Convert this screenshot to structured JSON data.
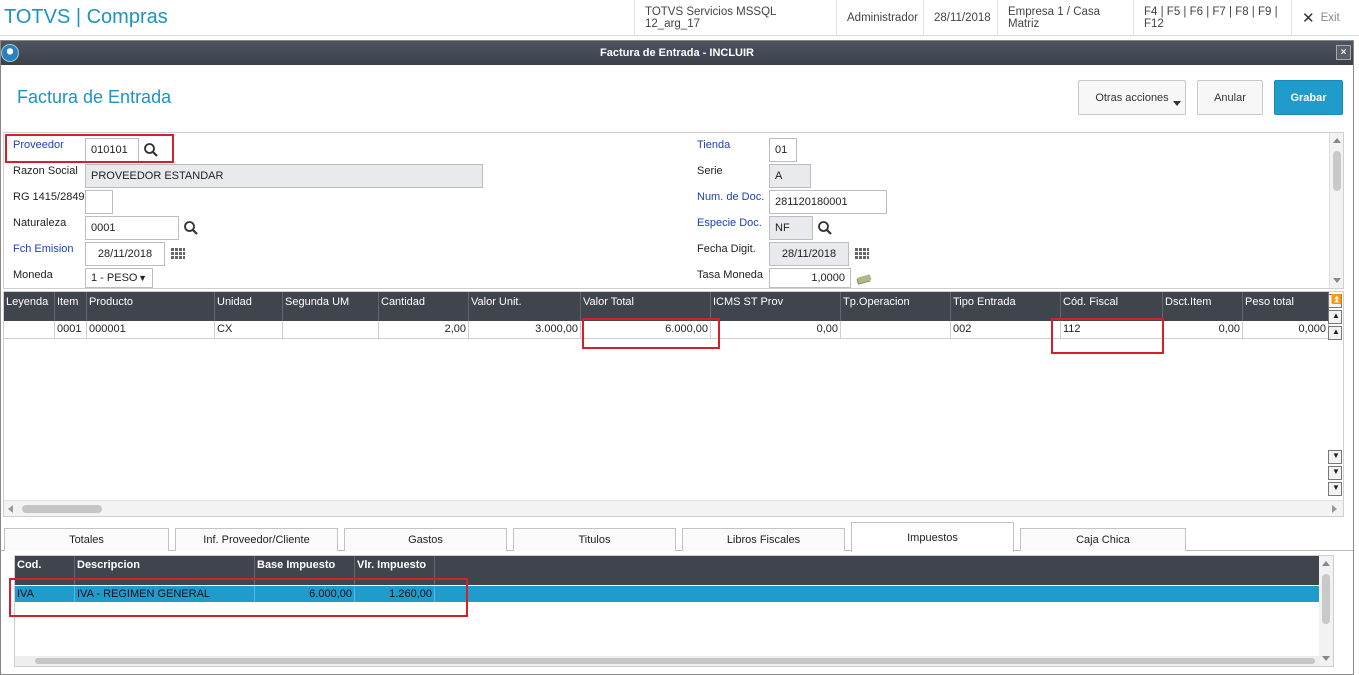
{
  "app": {
    "title": "TOTVS | Compras",
    "environment": "TOTVS Servicios MSSQL 12_arg_17",
    "user": "Administrador",
    "date": "28/11/2018",
    "company": "Empresa 1 / Casa Matriz",
    "shortcuts": "F4 | F5 | F6 | F7 | F8 | F9 | F12",
    "exit_label": "Exit"
  },
  "dialog": {
    "title": "Factura de Entrada - INCLUIR",
    "close_glyph": "×"
  },
  "header": {
    "page_title": "Factura de Entrada",
    "other_actions": "Otras acciones",
    "cancel": "Anular",
    "save": "Grabar"
  },
  "form": {
    "proveedor": {
      "label": "Proveedor",
      "value": "010101"
    },
    "razon_social": {
      "label": "Razon Social",
      "value": "PROVEEDOR ESTANDAR"
    },
    "rg": {
      "label": "RG 1415/2849",
      "value": ""
    },
    "naturaleza": {
      "label": "Naturaleza",
      "value": "0001"
    },
    "fch_emision": {
      "label": "Fch Emision",
      "value": "28/11/2018"
    },
    "moneda": {
      "label": "Moneda",
      "value": "1 - PESO"
    },
    "tienda": {
      "label": "Tienda",
      "value": "01"
    },
    "serie": {
      "label": "Serie",
      "value": "A"
    },
    "num_doc": {
      "label": "Num. de Doc.",
      "value": "281120180001"
    },
    "especie_doc": {
      "label": "Especie Doc.",
      "value": "NF"
    },
    "fecha_digit": {
      "label": "Fecha Digit.",
      "value": "28/11/2018"
    },
    "tasa_moneda": {
      "label": "Tasa Moneda",
      "value": "1,0000"
    }
  },
  "items_grid": {
    "columns": [
      "Leyenda",
      "Item",
      "Producto",
      "Unidad",
      "Segunda UM",
      "Cantidad",
      "Valor Unit.",
      "Valor Total",
      "ICMS ST Prov",
      "Tp.Operacion",
      "Tipo Entrada",
      "Cód. Fiscal",
      "Dsct.Item",
      "Peso total"
    ],
    "rows": [
      [
        "",
        "0001",
        "000001",
        "CX",
        "",
        "2,00",
        "3.000,00",
        "6.000,00",
        "0,00",
        "",
        "002",
        "112",
        "0,00",
        "0,000"
      ]
    ]
  },
  "tabs": [
    "Totales",
    "Inf. Proveedor/Cliente",
    "Gastos",
    "Titulos",
    "Libros Fiscales",
    "Impuestos",
    "Caja Chica"
  ],
  "active_tab": "Impuestos",
  "tax_grid": {
    "columns": [
      "Cod.",
      "Descripcion",
      "Base Impuesto",
      "Vlr. Impuesto"
    ],
    "rows": [
      [
        "IVA",
        "IVA - REGIMEN GENERAL",
        "6.000,00",
        "1.260,00"
      ]
    ]
  },
  "colors": {
    "accent": "#1f9ccb",
    "header_dark": "#3f444d",
    "highlight_red": "#d4202b",
    "required_label": "#1a3fb8"
  }
}
